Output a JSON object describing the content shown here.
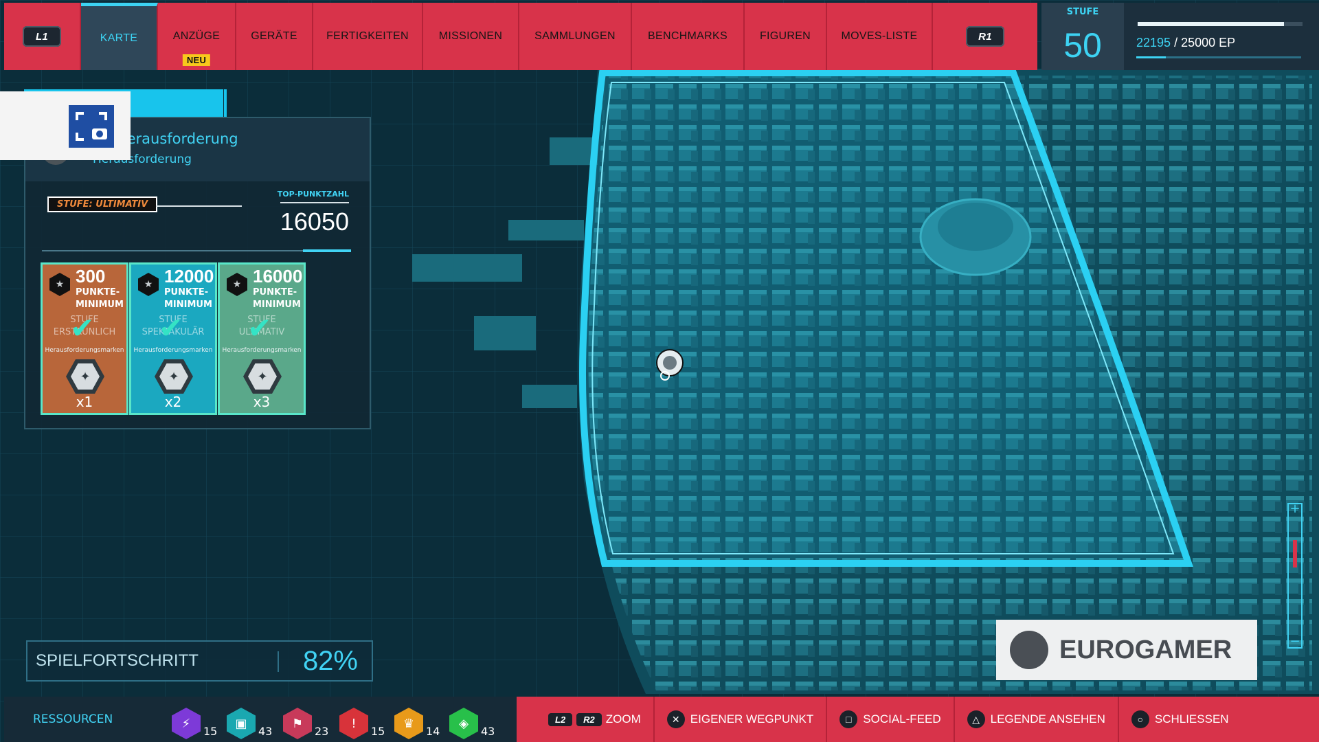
{
  "top_bar": {
    "l1": "L1",
    "r1": "R1",
    "tabs": [
      {
        "label": "KARTE"
      },
      {
        "label": "ANZÜGE",
        "badge": "NEU"
      },
      {
        "label": "GERÄTE"
      },
      {
        "label": "FERTIGKEITEN"
      },
      {
        "label": "MISSIONEN"
      },
      {
        "label": "SAMMLUNGEN"
      },
      {
        "label": "BENCHMARKS"
      },
      {
        "label": "FIGUREN"
      },
      {
        "label": "MOVES-LISTE"
      }
    ],
    "level_label": "STUFE",
    "level_value": "50",
    "xp_current": "22195",
    "xp_rest": " / 25000 EP",
    "xp_fraction": 0.888
  },
  "challenge": {
    "title": "en-Herausforderung",
    "subtitle": "Herausforderung",
    "stufe_label": "STUFE: ULTIMATIV",
    "top_label": "TOP-PUNKTZAHL",
    "top_value": "16050",
    "cards": [
      {
        "points": "300",
        "min1": "PUNKTE-",
        "min2": "MINIMUM",
        "stufe1": "STUFE",
        "stufe2": "ERSTAUNLICH",
        "marks": "Herausforderungsmarken",
        "count": "x1",
        "bg": "#b8663a"
      },
      {
        "points": "12000",
        "min1": "PUNKTE-",
        "min2": "MINIMUM",
        "stufe1": "STUFE",
        "stufe2": "SPEKTAKULÄR",
        "marks": "Herausforderungsmarken",
        "count": "x2",
        "bg": "#1ba8c0"
      },
      {
        "points": "16000",
        "min1": "PUNKTE-",
        "min2": "MINIMUM",
        "stufe1": "STUFE",
        "stufe2": "ULTIMATIV",
        "marks": "Herausforderungsmarken",
        "count": "x3",
        "bg": "#5aa88a"
      }
    ]
  },
  "progress": {
    "label": "SPIELFORTSCHRITT",
    "value": "82%"
  },
  "watermark": {
    "text": "EUROGAMER"
  },
  "zoom": {
    "plus": "+",
    "minus": "−",
    "level": 0.2
  },
  "resources": {
    "label": "RESSOURCEN",
    "items": [
      {
        "icon": "lightning-icon",
        "count": "15",
        "color": "#7d3ad8"
      },
      {
        "icon": "backpack-icon",
        "count": "43",
        "color": "#1aa8b0"
      },
      {
        "icon": "flag-icon",
        "count": "23",
        "color": "#c83a5a"
      },
      {
        "icon": "warning-icon",
        "count": "15",
        "color": "#d8333a"
      },
      {
        "icon": "trophy-icon",
        "count": "14",
        "color": "#e89a1a"
      },
      {
        "icon": "bag-icon",
        "count": "43",
        "color": "#28c04a"
      }
    ]
  },
  "actions": {
    "l2": "L2",
    "r2": "R2",
    "zoom": "ZOOM",
    "waypoint": "EIGENER WEGPUNKT",
    "social": "SOCIAL-FEED",
    "legend": "LEGENDE ANSEHEN",
    "close": "SCHLIESSEN"
  }
}
